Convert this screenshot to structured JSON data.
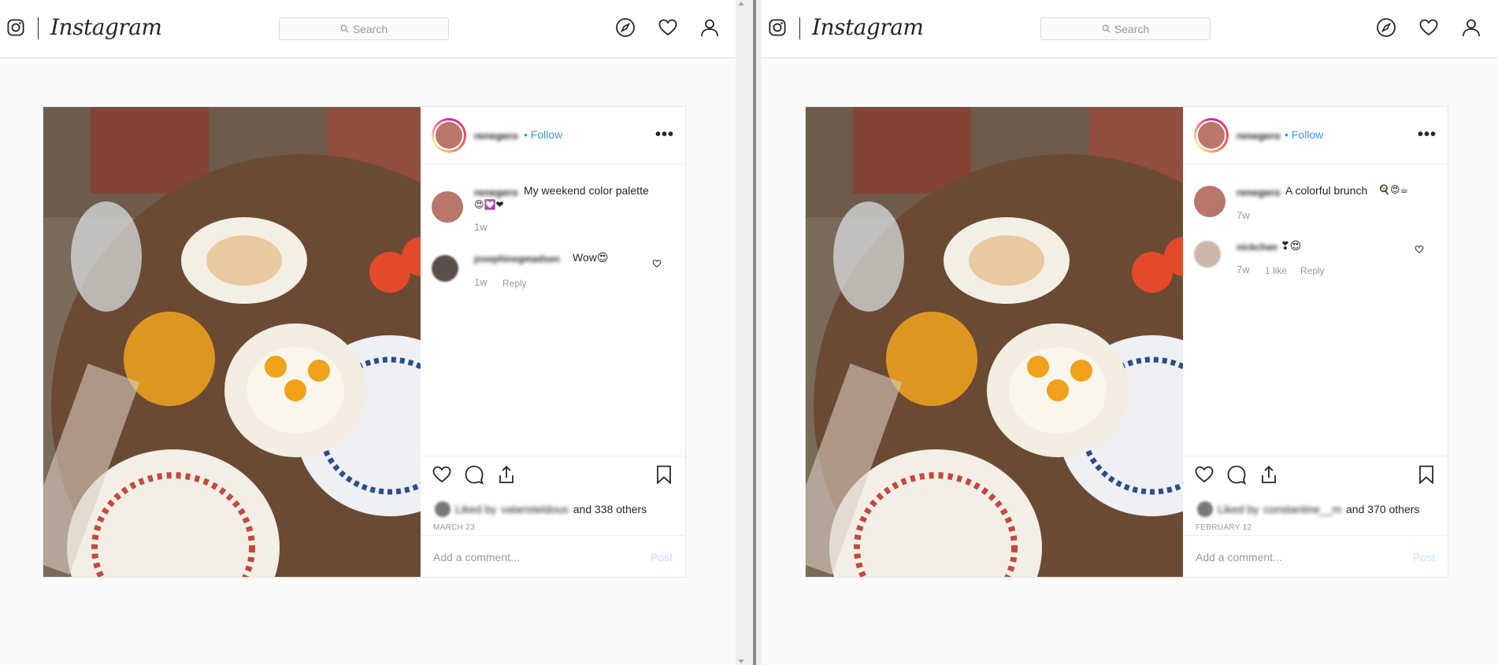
{
  "panes": [
    {
      "app": {
        "wordmark": "Instagram"
      },
      "search": {
        "placeholder": "Search"
      },
      "post": {
        "author": "renegero",
        "follow_label": "• Follow",
        "caption": "My weekend color palette",
        "caption_emoji": "😍💟❤",
        "caption_age": "1w",
        "comment": {
          "user": "josephinegmadsen",
          "text": "Wow😍",
          "age": "1w",
          "likes": "",
          "reply_label": "Reply"
        },
        "liked_by_prefix": "Liked by",
        "liked_by_user": "valaristeldous",
        "liked_by_suffix": "and 338 others",
        "date": "MARCH 23",
        "add_comment_placeholder": "Add a comment...",
        "post_button": "Post"
      }
    },
    {
      "app": {
        "wordmark": "Instagram"
      },
      "search": {
        "placeholder": "Search"
      },
      "post": {
        "author": "renegero",
        "follow_label": "• Follow",
        "caption": "A colorful brunch",
        "caption_emoji": "🍳😍☕",
        "caption_age": "7w",
        "comment": {
          "user": "nickchan",
          "text": "❣😍",
          "age": "7w",
          "likes": "1 like",
          "reply_label": "Reply"
        },
        "liked_by_prefix": "Liked by",
        "liked_by_user": "constantine__m",
        "liked_by_suffix": "and 370 others",
        "date": "FEBRUARY 12",
        "add_comment_placeholder": "Add a comment...",
        "post_button": "Post"
      }
    }
  ],
  "icons": [
    "instagram-logo-icon",
    "search-icon",
    "compass-icon",
    "heart-icon",
    "profile-icon",
    "more-options-icon",
    "like-icon",
    "comment-icon",
    "share-icon",
    "bookmark-icon"
  ],
  "colors": {
    "link": "#3897f0",
    "border": "#dbdbdb",
    "muted": "#999999",
    "post_disabled": "#c7dffc"
  }
}
